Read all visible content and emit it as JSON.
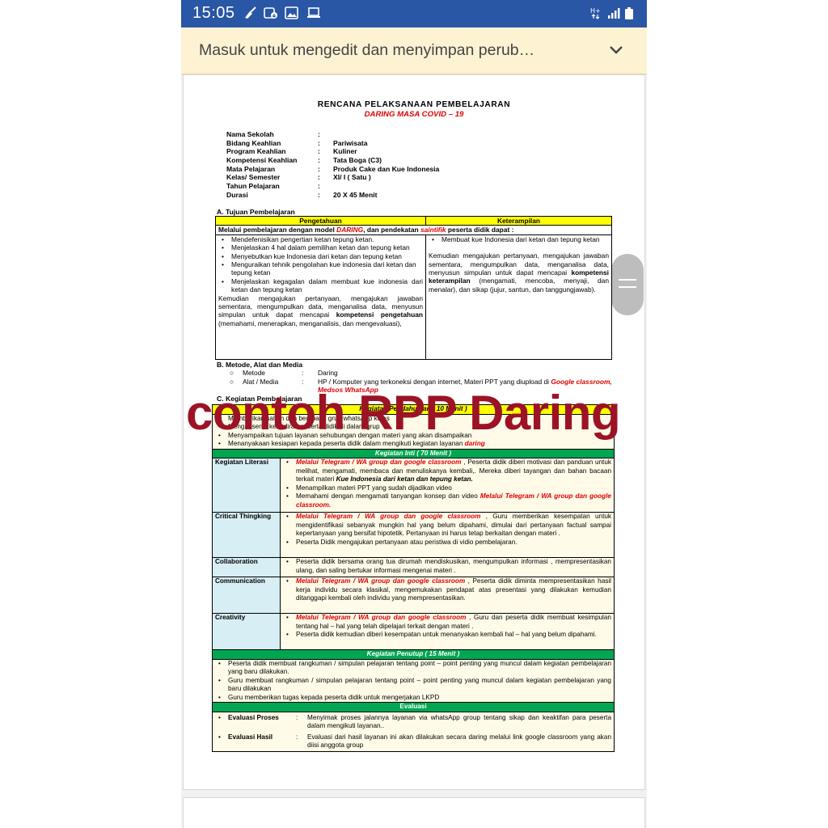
{
  "status_bar": {
    "time": "15:05"
  },
  "banner": {
    "text": "Masuk untuk mengedit dan menyimpan perub…"
  },
  "doc": {
    "title": "RENCANA  PELAKSANAAN  PEMBELAJARAN",
    "subtitle": "DARING MASA COVID – 19",
    "identity": [
      {
        "key": "Nama Sekolah",
        "value": ""
      },
      {
        "key": "Bidang Keahlian",
        "value": "Pariwisata"
      },
      {
        "key": "Program Keahlian",
        "value": "Kuliner"
      },
      {
        "key": "Kompetensi Keahlian",
        "value": "Tata Boga (C3)"
      },
      {
        "key": "Mata Pelajaran",
        "value": "Produk Cake dan Kue Indonesia"
      },
      {
        "key": "Kelas/ Semester",
        "value": "XI/ I ( Satu )"
      },
      {
        "key": "Tahun Pelajaran",
        "value": ""
      },
      {
        "key": "Durasi",
        "value": "20 X 45 Menit"
      }
    ],
    "section_a": {
      "heading": "A.   Tujuan  Pembelajaran",
      "col1": "Pengetahuan",
      "col2": "Keterampilan",
      "intro_1": "Melalui pembelajaran dengan model ",
      "intro_daring": "DARING",
      "intro_2": ", dan pendekatan ",
      "intro_saintifik": "saintifik",
      "intro_3": "  peserta didik dapat :",
      "left_bullets": [
        "Mendefenisikan pengertian ketan tepung ketan.",
        "Menjelaskan 4 hal dalam pemilihan ketan dan tepung ketan",
        "Menyebutkan kue Indonesia dari ketan dan tepung ketan",
        "Menguraikan tehnik pengolahan kue indonesia dari ketan dan tepung ketan",
        "Menjelaskan   kegagalan   dalam   membuat   kue indonesia dari ketan dan tepung ketan"
      ],
      "left_para_1": "Kemudian mengajukan pertanyaan, mengajukan jawaban sementara, mengumpulkan data, menganalisa data, menyusun simpulan untuk dapat mencapai ",
      "left_para_bold": "kompetensi pengetahuan",
      "left_para_2": " (memahami, menerapkan, menganalisis, dan mengevaluasi),",
      "right_bullets": [
        "Membuat kue Indonesia dari ketan dan tepung ketan"
      ],
      "right_para_1": "Kemudian mengajukan pertanyaan, mengajukan jawaban sementara, mengumpulkan data, menganalisa data, menyusun simpulan untuk dapat mencapai ",
      "right_para_bold": "kompetensi keterampilan",
      "right_para_2": " (mengamati, mencoba, menyaji, dan menalar), dan sikap (jujur, santun, dan tanggungjawab)."
    },
    "section_b": {
      "heading": "B.   Metode, Alat dan Media",
      "metode_label": "Metode",
      "metode_value": "Daring",
      "alat_label": "Alat / Media",
      "alat_value": "HP / Komputer yang terkoneksi dengan internet, Materi PPT yang diupload di ",
      "alat_red": "Google classroom, Medsos WhatsApp"
    },
    "section_c": {
      "heading": "C.   Kegiatan Pembelajaran",
      "pendahuluan_header": "Kegiatan Pendahuluan ( 10 Menit )",
      "pendahuluan_row1": "Memberikan salam dan berdoa di grup whatsApp kelas",
      "pendahuluan_row2": "Mengabsensi kehadiran peserta didik di dalam grup",
      "pendahuluan_row3": "Menyampaikan tujuan layanan sehubungan dengan materi yang akan disampaikan",
      "pendahuluan_row4a": "Menanyakaan kesiapan kepada peserta didik dalam mengikuti kegiatan layanan ",
      "pendahuluan_row4b": "daring",
      "inti_header": "Kegiatan Inti ( 70 Menit )",
      "literasi_label": "Kegiatan Literasi",
      "literasi_b1_red": "Melalui Telegram / WA  group dan google classroom",
      "literasi_b1_rest": " , Peserta didik diberi motivasi dan panduan untuk melihat, mengamati, membaca dan menuliskanya kembali,. Mereka diberi tayangan dan bahan bacaan terkait materi ",
      "literasi_b1_bi": "Kue Indonesia dari ketan dan  tepung ketan.",
      "literasi_b2": "Menampilkan materi PPT yang sudah dijadikan video",
      "literasi_b3": "Memahami  dengan mengamati tanyangan konsep dan video ",
      "literasi_b3_red": "Melalui Telegram / WA group dan google classroom.",
      "critical_label": "Critical Thingking",
      "critical_b1_red": "Melalui Telegram / WA  group dan google classroom",
      "critical_b1_rest": " , Guru memberikan kesempatan untuk mengidentifikasi sebanyak mungkin hal yang belum dipahami, dimulai dari pertanyaan factual sampai kepertanyaan yang bersifat hipotetik. Pertanyaan ini harus tetap berkaitan dengan materi .",
      "critical_b2": "Peserta Didik mengajukan pertanyaan atau peristiwa di vidio pembelajaran.",
      "collab_label": "Collaboration",
      "collab_b1": "Peserta didik bersama orang tua dirumah mendiskusikan, mengumpulkan informasi , mempresentasikan ulang, dan saling bertukar informasi mengenai materi .",
      "comm_label": "Communication",
      "comm_b1_red": "Melalui Telegram / WA   group dan google classroom",
      "comm_b1_rest": "  , Peserta didik diminta mempresentasikan hasil kerja individu secara klasikal, mengemukakan pendapat atas presentasi yang dilakukan kemudian ditanggapi kembali oleh individu yang mempresentasikan.",
      "creat_label": "Creativity",
      "creat_b1_red": "Melalui Telegram / WA  group dan google classroom",
      "creat_b1_rest": " , Guru dan peserta didik membuat kesimpulan tentang hal – hal yang telah dipelajari terkait dengan materi .",
      "creat_b2": "Peserta didik kemudian diberi kesempatan untuk menanyakan kembali hal – hal yang belum dipahami.",
      "penutup_header": "Kegiatan Penutup ( 15 Menit )",
      "penutup_b1": "Peserta didik membuat rangkuman / simpulan pelajaran tentang point – point penting yang muncul dalam kegiatan pembelajaran yang baru dilakukan.",
      "penutup_b2": "Guru membuat rangkuman / simpulan pelajaran tentang point – point penting yang muncul dalam kegiatan pembelajaran yang baru dilakukan",
      "penutup_b3": "Guru memberikan tugas kepada peserta didik untuk mengerjakan LKPD",
      "evaluasi_header": "Evaluasi",
      "eval_proses_label": "Evaluasi Proses",
      "eval_proses_value": "Menyimak proses jalannya layanan via whatsApp group tentang sikap dan keaktifan para peserta dalam mengikuti layanan..",
      "eval_hasil_label": "Evaluasi Hasil",
      "eval_hasil_value": "Evaluasi dari hasil layanan ini akan dilakukan secara daring melalui link google classroom yang akan diisi anggota group"
    }
  },
  "watermark": "contoh RPP Daring",
  "colors": {
    "status_bar": "#2a56a6",
    "banner": "#fdf2d2",
    "accent_red": "#dd0000",
    "yellow": "#ffff00",
    "green": "#00a651",
    "watermark": "#9c1326"
  }
}
